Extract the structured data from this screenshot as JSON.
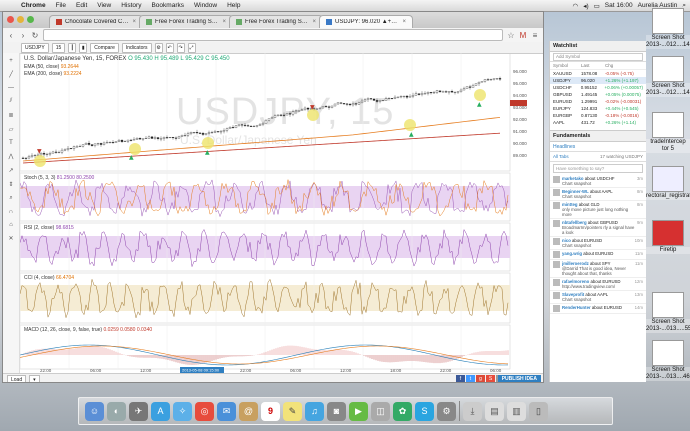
{
  "menubar": {
    "app": "Chrome",
    "menus": [
      "File",
      "Edit",
      "View",
      "History",
      "Bookmarks",
      "Window",
      "Help"
    ],
    "clock": "Sat 16:00",
    "user": "Aurelia Austin"
  },
  "browser": {
    "tabs": [
      {
        "label": "Chocolate Covered Cherri"
      },
      {
        "label": "Free Forex Trading Syste"
      },
      {
        "label": "Free Forex Trading Syste"
      },
      {
        "label": "USDJPY: 96.020 ▲+1.26%"
      }
    ]
  },
  "tv": {
    "toolbar": {
      "symbol": "USDJPY",
      "interval": "15",
      "compare": "Compare",
      "indicators": "Indicators"
    },
    "chart": {
      "title": "U.S. Dollar/Japanese Yen, 15, FOREX",
      "ohlc": "O 95.430 H 95.489 L 95.429 C 95.450",
      "ema1": "EMA (50, close)",
      "ema1_val": "93.2644",
      "ema2": "EMA (200, close)",
      "ema2_val": "93.2224",
      "watermark": "USDJPY, 15",
      "watermark_sub": "U.S. Dollar/Japanese Yen",
      "stoch_label": "Stoch (5, 3, 3)",
      "stoch_vals": "81.2500  80.2500",
      "rsi_label": "RSI (2, close)",
      "rsi_val": "98.6815",
      "cci_label": "CCI (4, close)",
      "cci_val": "66.4704",
      "macd_label": "MACD (12, 26, close, 9, false, true)",
      "macd_vals": "0.0259  0.0580  0.0340",
      "price_labels": [
        "96.000",
        "95.000",
        "94.000",
        "93.000",
        "92.000",
        "91.000",
        "90.000",
        "89.000"
      ],
      "time_labels": [
        "22:00",
        "06:00",
        "12:00",
        "18:00",
        "22:00",
        "06:00",
        "12:00",
        "18:00",
        "22:00",
        "06:00"
      ],
      "date_marker": "2013-05-08 09:15:00"
    },
    "bottombar": {
      "load": "Load",
      "publish": "PUBLISH IDEA"
    },
    "watchlist": {
      "title": "Watchlist",
      "add_symbol": "Add Symbol",
      "headers": [
        "Symbol",
        "Last",
        "Chg"
      ],
      "rows": [
        {
          "sym": "XAUUSD",
          "last": "1578.08",
          "chg": "-0.05% (-0.75)",
          "color": "#c0392b"
        },
        {
          "sym": "USDJPY",
          "last": "96.020",
          "chg": "+1.26% (+1.197)",
          "color": "#27ae60"
        },
        {
          "sym": "USDCHF",
          "last": "0.95152",
          "chg": "+0.06% (+0.00057)",
          "color": "#27ae60"
        },
        {
          "sym": "GBPUSD",
          "last": "1.49145",
          "chg": "+0.05% (0.00075)",
          "color": "#27ae60"
        },
        {
          "sym": "EURUSD",
          "last": "1.29991",
          "chg": "-0.02% (-0.00031)",
          "color": "#c0392b"
        },
        {
          "sym": "EURJPY",
          "last": "124.833",
          "chg": "+0.44% (+0.545)",
          "color": "#27ae60"
        },
        {
          "sym": "EURGBP",
          "last": "0.87130",
          "chg": "-0.18% (-0.0016)",
          "color": "#c0392b"
        },
        {
          "sym": "AAPL",
          "last": "431.72",
          "chg": "+0.26% (+1.14)",
          "color": "#27ae60"
        }
      ]
    },
    "fundamentals": {
      "title": "Fundamentals",
      "headlines": "Headlines",
      "all_tabs": "All Tabs",
      "watching": "17 watching USDJPY",
      "input_placeholder": "Have something to say?",
      "feed": [
        {
          "user": "marketako",
          "text": "about USDCHF",
          "sub": "Chart snapshot",
          "time": "3m"
        },
        {
          "user": "Beginner-WL",
          "text": "about AAPL",
          "sub": "Chart snapshot",
          "time": "8m"
        },
        {
          "user": "mintteg",
          "text": "about GLD",
          "sub": "only move picture just long nothing more",
          "time": "8m"
        },
        {
          "user": "nbtafellberg",
          "text": "about GBPUSD",
          "sub": "BroadmarIm/pointers rly a signal have a look",
          "time": "9m"
        },
        {
          "user": "nico",
          "text": "about EURUSD",
          "sub": "Chart snapshot",
          "time": "10m"
        },
        {
          "user": "yang.wrig",
          "text": "about EURUSD",
          "sub": "",
          "time": "11m"
        },
        {
          "user": "jmilleroerodz",
          "text": "about SPY",
          "sub": "@Darrid That is good idea, Never thought about that, thanks",
          "time": "11m"
        },
        {
          "user": "rafaelmoreno",
          "text": "about EURUSD",
          "sub": "http://www.tradingview.com/",
          "time": "12m"
        },
        {
          "user": "Slaveprofit",
          "text": "about AAPL",
          "sub": "Chart snapshot",
          "time": "13m"
        },
        {
          "user": "RenderHunter",
          "text": "about EURUSD",
          "sub": "",
          "time": "14m"
        }
      ]
    }
  },
  "desktop": {
    "icons": [
      {
        "label": "Screen Shot 2013-...012....14.31"
      },
      {
        "label": "Screen Shot 2013-...012....14.30"
      },
      {
        "label": "tradeIntercep tor 5"
      },
      {
        "label": "rectoral_registration.pdf"
      },
      {
        "label": "Firetip"
      },
      {
        "label": "Screen Shot 2013-...013.....55.57"
      },
      {
        "label": "Screen Shot 2013-...013....46.15"
      }
    ]
  },
  "dock": {
    "calendar_day": "9"
  }
}
